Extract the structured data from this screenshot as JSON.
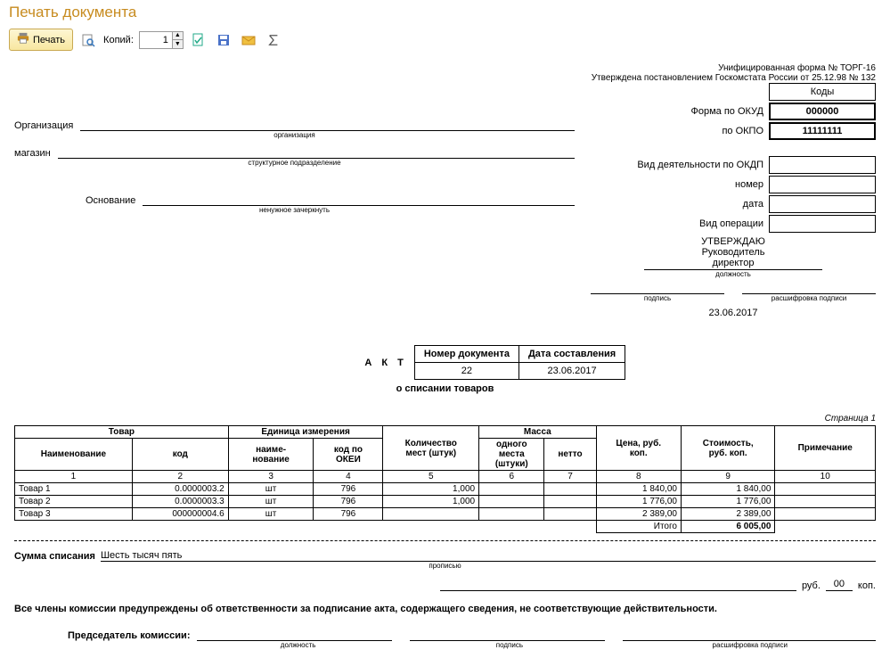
{
  "header": {
    "title": "Печать документа"
  },
  "toolbar": {
    "print_label": "Печать",
    "copies_label": "Копий:",
    "copies_value": "1"
  },
  "meta": {
    "form_line": "Унифицированная форма № ТОРГ-16",
    "approved_line": "Утверждена постановлением Госкомстата России от 25.12.98 № 132"
  },
  "codes": {
    "hdr": "Коды",
    "okud_label": "Форма по ОКУД",
    "okud_value": "000000",
    "okpo_label": "по ОКПО",
    "okpo_value": "11111111",
    "okdp_label": "Вид деятельности по ОКДП",
    "number_label": "номер",
    "date_label": "дата",
    "optype_label": "Вид операции"
  },
  "org": {
    "label": "Организация",
    "sub": "организация",
    "shop_label": "магазин",
    "shop_sub": "структурное подразделение",
    "reason_label": "Основание",
    "reason_sub": "ненужное зачеркнуть"
  },
  "approve": {
    "l1": "УТВЕРЖДАЮ",
    "l2": "Руководитель",
    "pos": "директор",
    "pos_sub": "должность",
    "sig_sub": "подпись",
    "dec_sub": "расшифровка подписи",
    "date": "23.06.2017"
  },
  "act": {
    "title": "А К Т",
    "sub": "о списании товаров",
    "doc_num_h": "Номер документа",
    "doc_date_h": "Дата составления",
    "doc_num": "22",
    "doc_date": "23.06.2017"
  },
  "page": "Страница 1",
  "table": {
    "h_goods": "Товар",
    "h_name": "Наименование",
    "h_code": "код",
    "h_unit": "Единица измерения",
    "h_unit_name": "наиме-\nнование",
    "h_okei": "код по\nОКЕИ",
    "h_qty": "Количество\nмест (штук)",
    "h_mass": "Масса",
    "h_mass_one": "одного\nместа\n(штуки)",
    "h_netto": "нетто",
    "h_price": "Цена, руб.\nкоп.",
    "h_cost": "Стоимость,\nруб. коп.",
    "h_note": "Примечание",
    "cols": [
      "1",
      "2",
      "3",
      "4",
      "5",
      "6",
      "7",
      "8",
      "9",
      "10"
    ],
    "rows": [
      {
        "name": "Товар 1",
        "code": "0.0000003.2",
        "unit": "шт",
        "okei": "796",
        "qty": "1,000",
        "m1": "",
        "m2": "",
        "price": "1 840,00",
        "cost": "1 840,00",
        "note": ""
      },
      {
        "name": "Товар 2",
        "code": "0.0000003.3",
        "unit": "шт",
        "okei": "796",
        "qty": "1,000",
        "m1": "",
        "m2": "",
        "price": "1 776,00",
        "cost": "1 776,00",
        "note": ""
      },
      {
        "name": "Товар 3",
        "code": "000000004.6",
        "unit": "шт",
        "okei": "796",
        "qty": "",
        "m1": "",
        "m2": "",
        "price": "2 389,00",
        "cost": "2 389,00",
        "note": ""
      }
    ],
    "total_label": "Итого",
    "total": "6 005,00"
  },
  "sum": {
    "label": "Сумма списания",
    "words": "Шесть тысяч пять",
    "words_sub": "прописью",
    "rub": "руб.",
    "kop_val": "00",
    "kop": "коп."
  },
  "declaration": "Все члены комиссии предупреждены об ответственности за подписание акта, содержащего сведения, не соответствующие действительности.",
  "chair": {
    "label": "Председатель комиссии:",
    "col1": "должность",
    "col2": "подпись",
    "col3": "расшифровка подписи"
  }
}
